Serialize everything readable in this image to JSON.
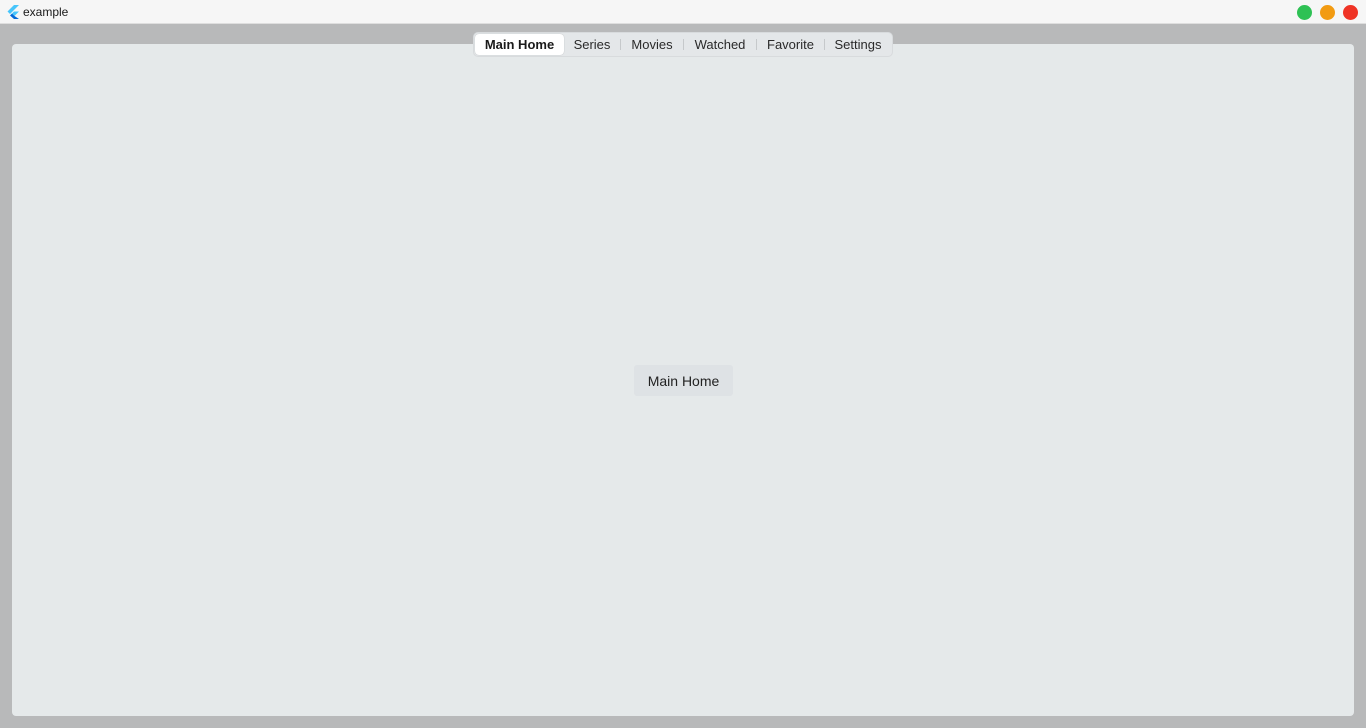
{
  "window": {
    "title": "example",
    "controls": {
      "maximize_color": "#2ec154",
      "minimize_color": "#f29b12",
      "close_color": "#ef3325"
    }
  },
  "tabs": [
    {
      "label": "Main Home",
      "active": true
    },
    {
      "label": "Series",
      "active": false
    },
    {
      "label": "Movies",
      "active": false
    },
    {
      "label": "Watched",
      "active": false
    },
    {
      "label": "Favorite",
      "active": false
    },
    {
      "label": "Settings",
      "active": false
    }
  ],
  "main": {
    "content_label": "Main Home"
  },
  "icons": {
    "app_logo": "flutter-logo-icon"
  }
}
